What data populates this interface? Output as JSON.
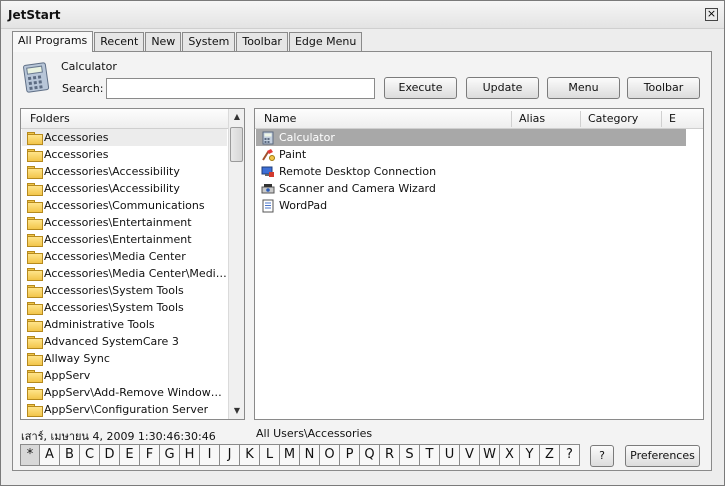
{
  "window": {
    "title": "JetStart",
    "close_glyph": "×"
  },
  "tabs": [
    {
      "label": "All Programs",
      "active": true
    },
    {
      "label": "Recent"
    },
    {
      "label": "New"
    },
    {
      "label": "System"
    },
    {
      "label": "Toolbar"
    },
    {
      "label": "Edge Menu"
    }
  ],
  "selected_program": {
    "name": "Calculator",
    "icon": "calculator-icon"
  },
  "search": {
    "label": "Search:",
    "value": ""
  },
  "buttons": {
    "execute": "Execute",
    "update": "Update",
    "menu": "Menu",
    "toolbar": "Toolbar"
  },
  "folders": {
    "header": "Folders",
    "items": [
      "Accessories",
      "Accessories",
      "Accessories\\Accessibility",
      "Accessories\\Accessibility",
      "Accessories\\Communications",
      "Accessories\\Entertainment",
      "Accessories\\Entertainment",
      "Accessories\\Media Center",
      "Accessories\\Media Center\\Media C...",
      "Accessories\\System Tools",
      "Accessories\\System Tools",
      "Administrative Tools",
      "Advanced SystemCare 3",
      "Allway Sync",
      "AppServ",
      "AppServ\\Add-Remove Windows Se...",
      "AppServ\\Configuration Server"
    ]
  },
  "programs": {
    "columns": {
      "name": "Name",
      "alias": "Alias",
      "category": "Category",
      "extra": "E"
    },
    "items": [
      {
        "name": "Calculator",
        "icon": "calculator-icon"
      },
      {
        "name": "Paint",
        "icon": "paint-icon"
      },
      {
        "name": "Remote Desktop Connection",
        "icon": "remote-desktop-icon"
      },
      {
        "name": "Scanner and Camera Wizard",
        "icon": "scanner-icon"
      },
      {
        "name": "WordPad",
        "icon": "wordpad-icon"
      }
    ]
  },
  "status": {
    "datetime": "เสาร์, เมษายน 4, 2009 1:30:46:30:46",
    "path": "All Users\\Accessories"
  },
  "alphabet": [
    "*",
    "A",
    "B",
    "C",
    "D",
    "E",
    "F",
    "G",
    "H",
    "I",
    "J",
    "K",
    "L",
    "M",
    "N",
    "O",
    "P",
    "Q",
    "R",
    "S",
    "T",
    "U",
    "V",
    "W",
    "X",
    "Y",
    "Z",
    "?"
  ],
  "bottom_buttons": {
    "help": "?",
    "preferences": "Preferences"
  },
  "colors": {
    "selection": "#a8a8a8",
    "folder": "#f2c54a"
  }
}
